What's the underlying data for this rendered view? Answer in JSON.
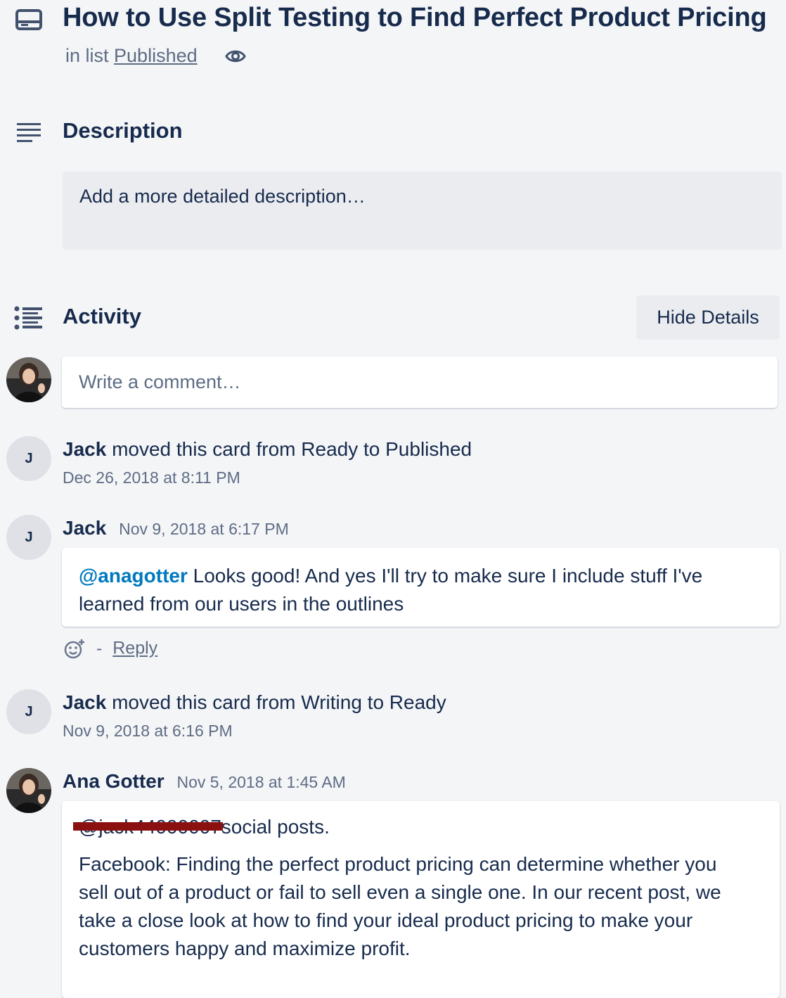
{
  "card": {
    "title": "How to Use Split Testing to Find Perfect Product Pricing",
    "in_list_prefix": "in list",
    "list_name": "Published"
  },
  "description": {
    "heading": "Description",
    "placeholder": "Add a more detailed description…"
  },
  "activity": {
    "heading": "Activity",
    "hide_details_label": "Hide Details",
    "comment_placeholder": "Write a comment…",
    "entries": [
      {
        "author": "Jack",
        "initial": "J",
        "action": "moved this card from Ready to Published",
        "time": "Dec 26, 2018 at 8:11 PM"
      },
      {
        "author": "Jack",
        "initial": "J",
        "time": "Nov 9, 2018 at 6:17 PM",
        "mention": "@anagotter",
        "comment_line1": "Looks good! And yes I'll try to make sure I include stuff I've",
        "comment_line2": "learned from our users in the outlines",
        "separator": "-",
        "reply_label": "Reply"
      },
      {
        "author": "Jack",
        "initial": "J",
        "action": "moved this card from Writing to Ready",
        "time": "Nov 9, 2018 at 6:16 PM"
      },
      {
        "author": "Ana Gotter",
        "time": "Nov 5, 2018 at 1:45 AM",
        "redacted_mention": "@jack44000007",
        "first_line_rest": "social posts.",
        "para_lines": [
          "Facebook: Finding the perfect product pricing can determine whether you",
          "sell out of a product or fail to sell even a single one. In our recent post, we",
          "take a close look at how to find your ideal product pricing to make your",
          "customers happy and maximize profit."
        ]
      }
    ]
  },
  "colors": {
    "background": "#f4f5f7",
    "text": "#172b4d",
    "muted": "#5e6c84",
    "mention": "#0079bf",
    "redaction": "#8b1010"
  }
}
